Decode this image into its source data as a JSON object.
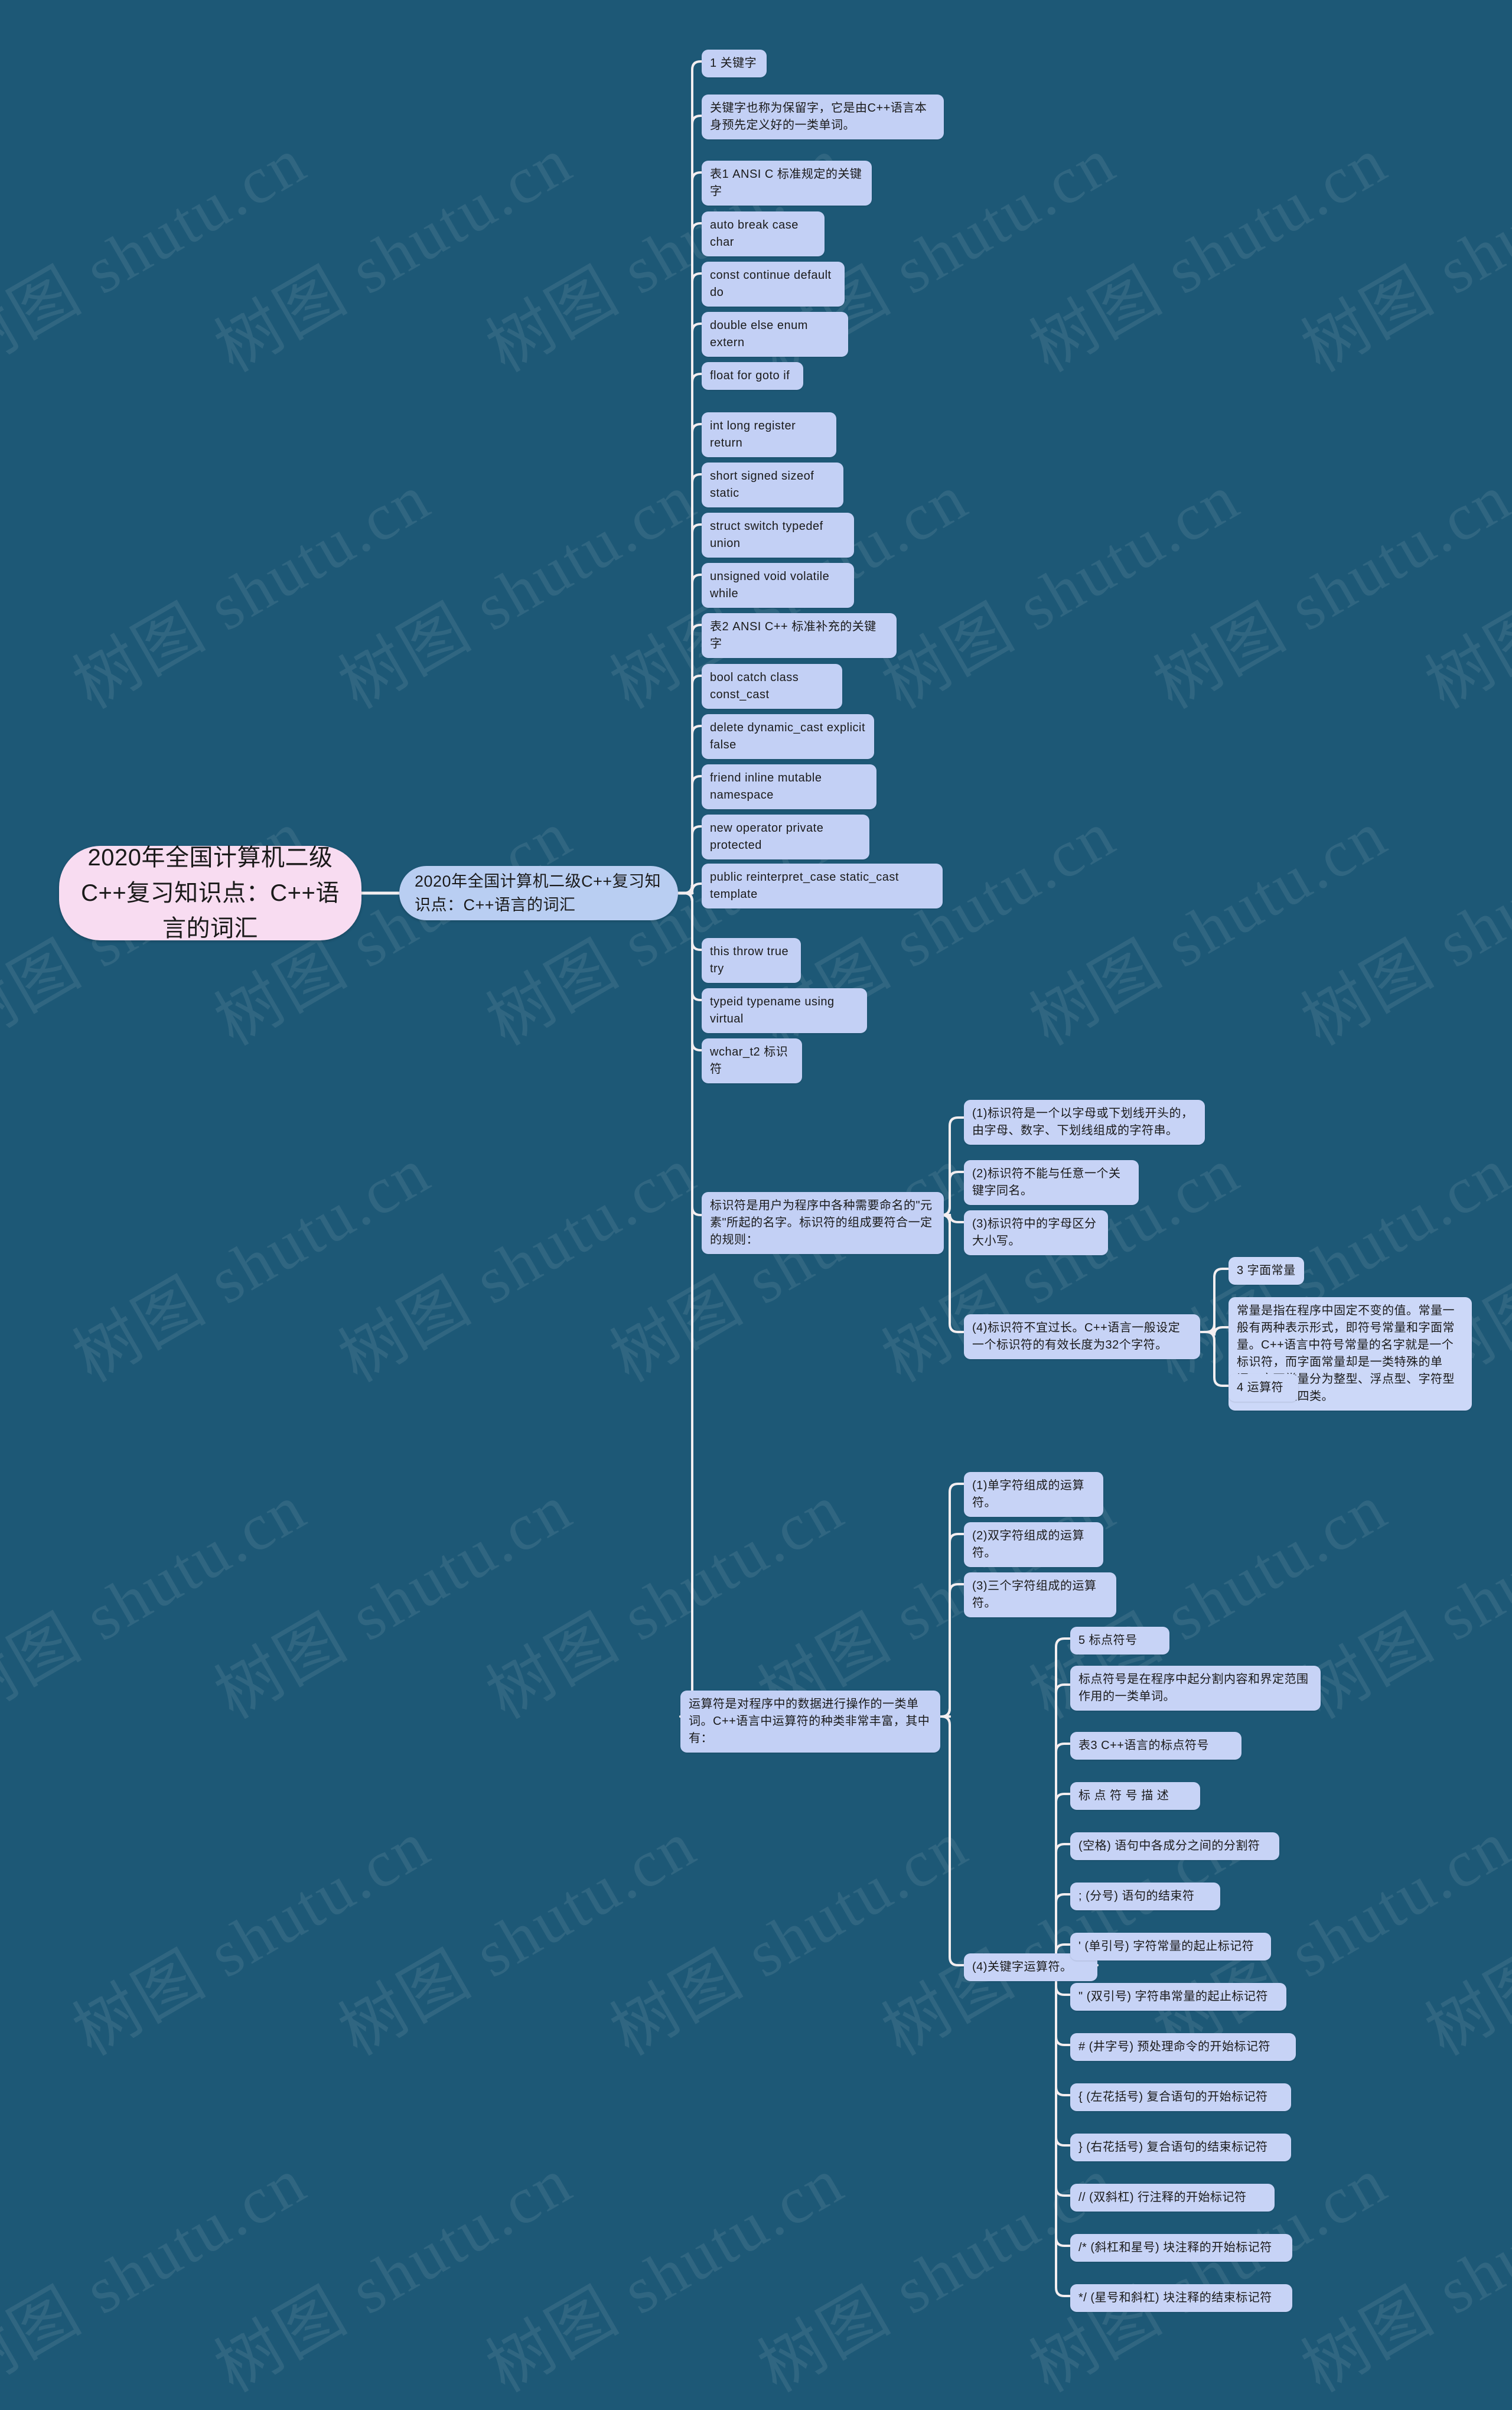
{
  "meta": {
    "background_color": "#1d5876",
    "root_color": "#f8dcf1",
    "branch_color": "#bdcdf4",
    "link_color": "#f3eef0",
    "watermark_text": "树图 shutu.cn"
  },
  "root": {
    "label": "2020年全国计算机二级C++复习知识点：C++语言的词汇"
  },
  "level2": {
    "label": "2020年全国计算机二级C++复习知识点：C++语言的词汇"
  },
  "branches": [
    {
      "id": "kw-title",
      "label": "1 关键字"
    },
    {
      "id": "kw-desc",
      "label": "关键字也称为保留字，它是由C++语言本身预先定义好的一类单词。"
    },
    {
      "id": "kw-table1",
      "label": "表1 ANSI C 标准规定的关键字"
    },
    {
      "id": "kw-row1",
      "label": "auto break case char"
    },
    {
      "id": "kw-row2",
      "label": "const continue default do"
    },
    {
      "id": "kw-row3",
      "label": "double else enum extern"
    },
    {
      "id": "kw-row4",
      "label": "float for goto if"
    },
    {
      "id": "kw-row5",
      "label": "int long register return"
    },
    {
      "id": "kw-row6",
      "label": "short signed sizeof static"
    },
    {
      "id": "kw-row7",
      "label": "struct switch typedef union"
    },
    {
      "id": "kw-row8",
      "label": "unsigned void volatile while"
    },
    {
      "id": "kw-table2",
      "label": "表2 ANSI C++ 标准补充的关键字"
    },
    {
      "id": "kw-row9",
      "label": "bool catch class const_cast"
    },
    {
      "id": "kw-row10",
      "label": "delete dynamic_cast explicit false"
    },
    {
      "id": "kw-row11",
      "label": "friend inline mutable namespace"
    },
    {
      "id": "kw-row12",
      "label": "new operator private protected"
    },
    {
      "id": "kw-row13",
      "label": "public reinterpret_case static_cast template"
    },
    {
      "id": "kw-row14",
      "label": "this throw true try"
    },
    {
      "id": "kw-row15",
      "label": "typeid typename using virtual"
    },
    {
      "id": "kw-row16",
      "label": "wchar_t2 标识符"
    },
    {
      "id": "id-desc",
      "label": "标识符是用户为程序中各种需要命名的\"元素\"所起的名字。标识符的组成要符合一定的规则："
    },
    {
      "id": "op-desc",
      "label": "运算符是对程序中的数据进行操作的一类单词。C++语言中运算符的种类非常丰富，其中有："
    }
  ],
  "identifier_rules": [
    {
      "id": "id-rule-1",
      "label": "(1)标识符是一个以字母或下划线开头的，由字母、数字、下划线组成的字符串。"
    },
    {
      "id": "id-rule-2",
      "label": "(2)标识符不能与任意一个关键字同名。"
    },
    {
      "id": "id-rule-3",
      "label": "(3)标识符中的字母区分大小写。"
    },
    {
      "id": "id-rule-4",
      "label": "(4)标识符不宜过长。C++语言一般设定一个标识符的有效长度为32个字符。"
    }
  ],
  "constant_group": [
    {
      "id": "const-title",
      "label": "3 字面常量"
    },
    {
      "id": "const-desc",
      "label": "常量是指在程序中固定不变的值。常量一般有两种表示形式，即符号常量和字面常量。C++语言中符号常量的名字就是一个标识符，而字面常量却是一类特殊的单词。字面常量分为整型、浮点型、字符型和字符串型四类。"
    },
    {
      "id": "op-title",
      "label": "4 运算符"
    }
  ],
  "operator_rules": [
    {
      "id": "op-rule-1",
      "label": "(1)单字符组成的运算符。"
    },
    {
      "id": "op-rule-2",
      "label": "(2)双字符组成的运算符。"
    },
    {
      "id": "op-rule-3",
      "label": "(3)三个字符组成的运算符。"
    },
    {
      "id": "op-rule-4",
      "label": "(4)关键字运算符。"
    }
  ],
  "punctuation_group": [
    {
      "id": "punc-title",
      "label": "5 标点符号"
    },
    {
      "id": "punc-desc",
      "label": "标点符号是在程序中起分割内容和界定范围作用的一类单词。"
    },
    {
      "id": "punc-table3",
      "label": "表3 C++语言的标点符号"
    },
    {
      "id": "punc-header",
      "label": "标 点 符 号 描 述"
    },
    {
      "id": "punc-1",
      "label": "(空格) 语句中各成分之间的分割符"
    },
    {
      "id": "punc-2",
      "label": "; (分号) 语句的结束符"
    },
    {
      "id": "punc-3",
      "label": "' (单引号) 字符常量的起止标记符"
    },
    {
      "id": "punc-4",
      "label": "\" (双引号) 字符串常量的起止标记符"
    },
    {
      "id": "punc-5",
      "label": "# (井字号) 预处理命令的开始标记符"
    },
    {
      "id": "punc-6",
      "label": "{ (左花括号) 复合语句的开始标记符"
    },
    {
      "id": "punc-7",
      "label": "}  (右花括号) 复合语句的结束标记符"
    },
    {
      "id": "punc-8",
      "label": "// (双斜杠) 行注释的开始标记符"
    },
    {
      "id": "punc-9",
      "label": "/* (斜杠和星号) 块注释的开始标记符"
    },
    {
      "id": "punc-10",
      "label": "*/ (星号和斜杠) 块注释的结束标记符"
    }
  ]
}
